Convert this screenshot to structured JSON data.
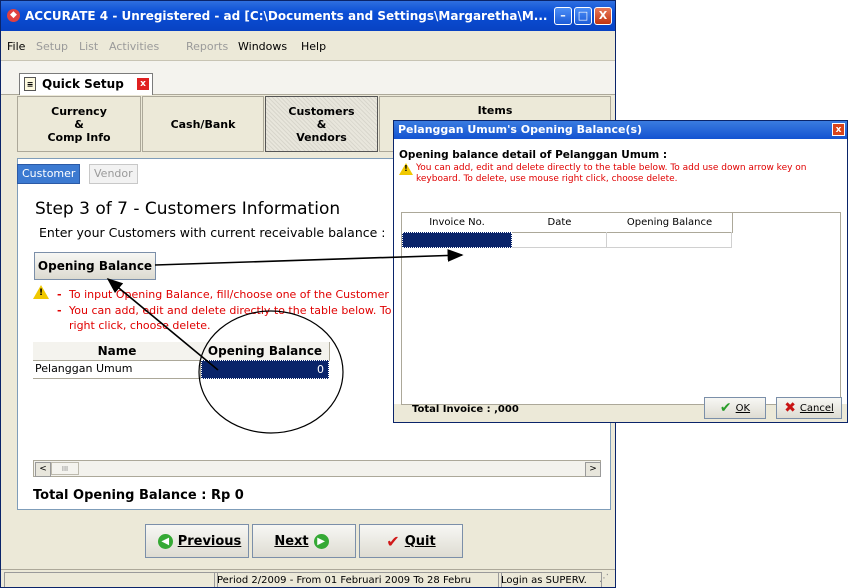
{
  "main_window": {
    "title": "ACCURATE 4 - Unregistered - ad  [C:\\Documents and Settings\\Margaretha\\M...",
    "minimize_glyph": "–",
    "maximize_glyph": "□",
    "close_glyph": "X"
  },
  "menu": {
    "items": [
      {
        "label": "File",
        "enabled": true
      },
      {
        "label": "Setup",
        "enabled": false
      },
      {
        "label": "List",
        "enabled": false
      },
      {
        "label": "Activities",
        "enabled": false
      },
      {
        "label": "Reports",
        "enabled": false
      },
      {
        "label": "Windows",
        "enabled": true
      },
      {
        "label": "Help",
        "enabled": true
      }
    ]
  },
  "quick_setup_tab": {
    "label": "Quick Setup",
    "close_glyph": "x"
  },
  "steps": [
    {
      "label": "Currency\n&\nComp Info",
      "selected": false
    },
    {
      "label": "Cash/Bank",
      "selected": false
    },
    {
      "label": "Customers\n&\nVendors",
      "selected": true
    },
    {
      "label": "Items",
      "selected": false
    }
  ],
  "sub_tabs": {
    "customer": "Customer",
    "vendor": "Vendor"
  },
  "step_title": "Step 3 of 7  - Customers Information",
  "step_subtitle": "Enter your Customers with current receivable balance :",
  "opening_balance_button": "Opening Balance",
  "notes": {
    "line1": "To input Opening Balance, fill/choose one of the Customer N",
    "line2": "You can add, edit and delete directly to the table below. To",
    "line3": "right click, choose delete.",
    "dash": "-"
  },
  "customer_table": {
    "headers": [
      "Name",
      "Opening Balance"
    ],
    "rows": [
      {
        "name": "Pelanggan Umum",
        "balance": "0"
      }
    ]
  },
  "scroll": {
    "left": "<",
    "right": ">",
    "thumb": "III"
  },
  "total_opening_balance": "Total Opening Balance : Rp 0",
  "nav": {
    "previous": "Previous",
    "next": "Next",
    "quit": "Quit"
  },
  "status_bar": {
    "period": "Period 2/2009 - From 01 Februari 2009 To 28 Febru",
    "login": "Login as SUPERV."
  },
  "dialog": {
    "title": "Pelanggan Umum's Opening Balance(s)",
    "close_glyph": "x",
    "heading": "Opening balance detail of Pelanggan Umum :",
    "info_line1": "You can add, edit and delete directly to the table below. To add use down arrow key on",
    "info_line2": "keyboard. To delete, use mouse right click, choose delete.",
    "columns": [
      "Invoice No.",
      "Date",
      "Opening Balance"
    ],
    "total_invoice": "Total Invoice : ,000",
    "ok": "OK",
    "cancel": "Cancel"
  },
  "colors": {
    "title_bar": "#0a4ed6",
    "selection": "#0a246a",
    "warning_red": "#e00000",
    "ok_green": "#2a9d2a",
    "cancel_red": "#c81414"
  }
}
